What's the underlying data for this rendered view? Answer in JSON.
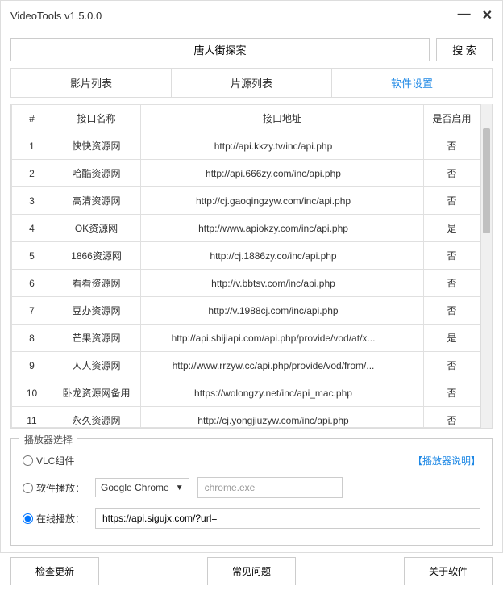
{
  "window": {
    "title": "VideoTools v1.5.0.0"
  },
  "search": {
    "value": "唐人街探案",
    "button": "搜 索"
  },
  "tabs": {
    "t0": "影片列表",
    "t1": "片源列表",
    "t2": "软件设置"
  },
  "table": {
    "headers": {
      "num": "#",
      "name": "接口名称",
      "url": "接口地址",
      "enable": "是否启用"
    },
    "rows": [
      {
        "n": "1",
        "name": "快快资源网",
        "url": "http://api.kkzy.tv/inc/api.php",
        "enable": "否"
      },
      {
        "n": "2",
        "name": "哈酷资源网",
        "url": "http://api.666zy.com/inc/api.php",
        "enable": "否"
      },
      {
        "n": "3",
        "name": "高清资源网",
        "url": "http://cj.gaoqingzyw.com/inc/api.php",
        "enable": "否"
      },
      {
        "n": "4",
        "name": "OK资源网",
        "url": "http://www.apiokzy.com/inc/api.php",
        "enable": "是"
      },
      {
        "n": "5",
        "name": "1866资源网",
        "url": "http://cj.1886zy.co/inc/api.php",
        "enable": "否"
      },
      {
        "n": "6",
        "name": "看看资源网",
        "url": "http://v.bbtsv.com/inc/api.php",
        "enable": "否"
      },
      {
        "n": "7",
        "name": "豆办资源网",
        "url": "http://v.1988cj.com/inc/api.php",
        "enable": "否"
      },
      {
        "n": "8",
        "name": "芒果资源网",
        "url": "http://api.shijiapi.com/api.php/provide/vod/at/x...",
        "enable": "是"
      },
      {
        "n": "9",
        "name": "人人资源网",
        "url": "http://www.rrzyw.cc/api.php/provide/vod/from/...",
        "enable": "否"
      },
      {
        "n": "10",
        "name": "卧龙资源网备用",
        "url": "https://wolongzy.net/inc/api_mac.php",
        "enable": "否"
      },
      {
        "n": "11",
        "name": "永久资源网",
        "url": "http://cj.yongjiuzyw.com/inc/api.php",
        "enable": "否"
      }
    ]
  },
  "player": {
    "title": "播放器选择",
    "vlc": "VLC组件",
    "help": "【播放器说明】",
    "software_label": "软件播放：",
    "software_select": "Google Chrome",
    "software_path": "chrome.exe",
    "online_label": "在线播放：",
    "online_url": "https://api.sigujx.com/?url="
  },
  "footer": {
    "update": "检查更新",
    "faq": "常见问题",
    "about": "关于软件"
  }
}
